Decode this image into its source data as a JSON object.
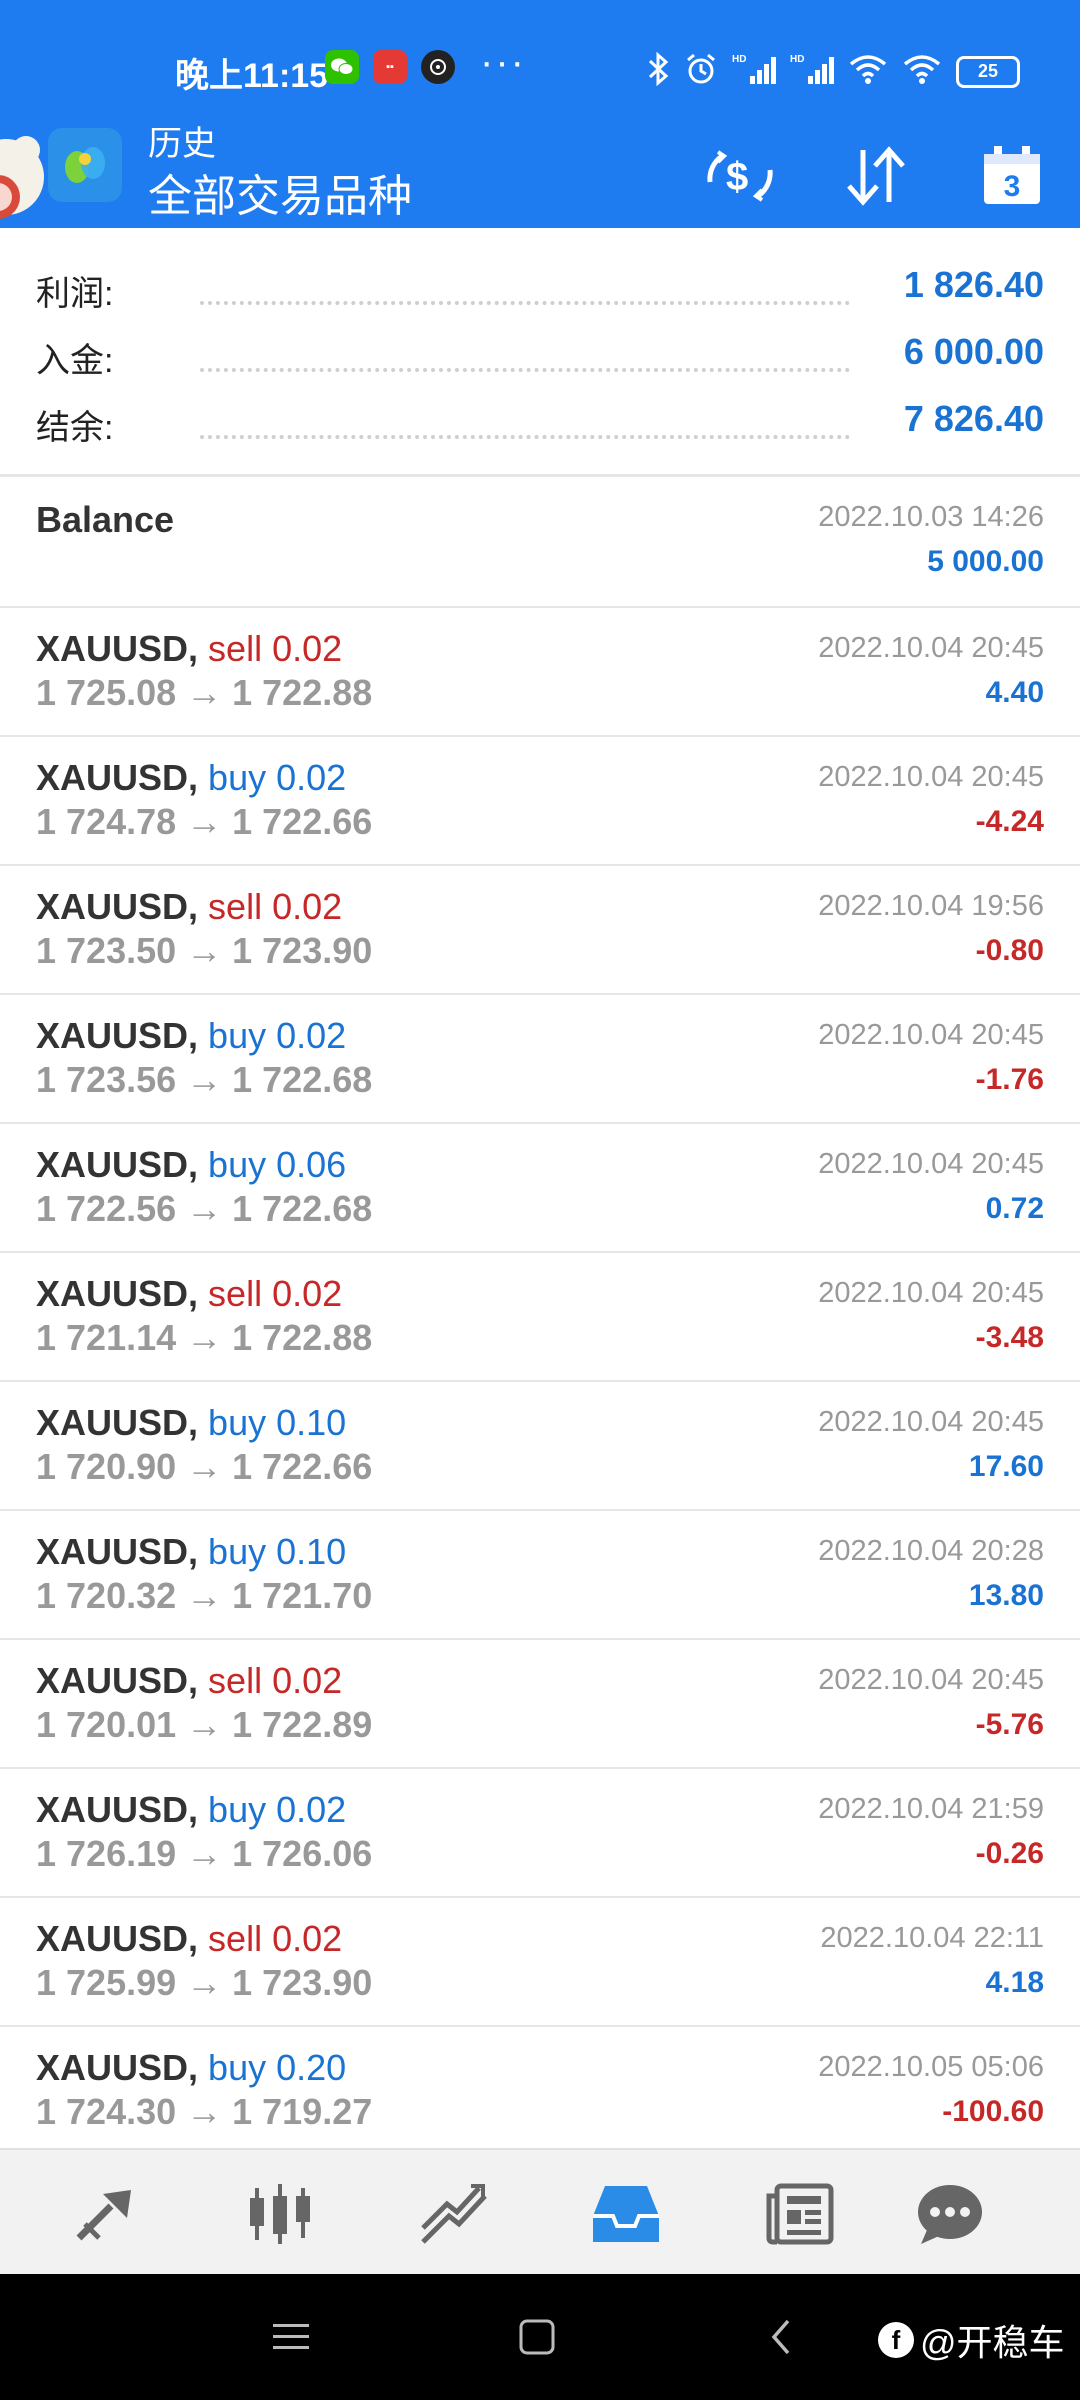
{
  "status_bar": {
    "time": "晚上11:15",
    "more": "···",
    "battery": "25",
    "app_icons": [
      "wechat-icon",
      "alipay-mini-icon",
      "camera-app-icon"
    ]
  },
  "header": {
    "title": "历史",
    "subtitle": "全部交易品种",
    "calendar_day": "3"
  },
  "summary": [
    {
      "label": "利润:",
      "value": "1 826.40"
    },
    {
      "label": "入金:",
      "value": "6 000.00"
    },
    {
      "label": "结余:",
      "value": "7 826.40"
    }
  ],
  "balance_entry": {
    "title": "Balance",
    "time": "2022.10.03 14:26",
    "amount": "5 000.00"
  },
  "trades": [
    {
      "symbol": "XAUUSD,",
      "side": "sell 0.02",
      "type": "sell",
      "prices": "1 725.08 → 1 722.88",
      "time": "2022.10.04 20:45",
      "profit": "4.40",
      "sign": "pos"
    },
    {
      "symbol": "XAUUSD,",
      "side": "buy 0.02",
      "type": "buy",
      "prices": "1 724.78 → 1 722.66",
      "time": "2022.10.04 20:45",
      "profit": "-4.24",
      "sign": "neg"
    },
    {
      "symbol": "XAUUSD,",
      "side": "sell 0.02",
      "type": "sell",
      "prices": "1 723.50 → 1 723.90",
      "time": "2022.10.04 19:56",
      "profit": "-0.80",
      "sign": "neg"
    },
    {
      "symbol": "XAUUSD,",
      "side": "buy 0.02",
      "type": "buy",
      "prices": "1 723.56 → 1 722.68",
      "time": "2022.10.04 20:45",
      "profit": "-1.76",
      "sign": "neg"
    },
    {
      "symbol": "XAUUSD,",
      "side": "buy 0.06",
      "type": "buy",
      "prices": "1 722.56 → 1 722.68",
      "time": "2022.10.04 20:45",
      "profit": "0.72",
      "sign": "pos"
    },
    {
      "symbol": "XAUUSD,",
      "side": "sell 0.02",
      "type": "sell",
      "prices": "1 721.14 → 1 722.88",
      "time": "2022.10.04 20:45",
      "profit": "-3.48",
      "sign": "neg"
    },
    {
      "symbol": "XAUUSD,",
      "side": "buy 0.10",
      "type": "buy",
      "prices": "1 720.90 → 1 722.66",
      "time": "2022.10.04 20:45",
      "profit": "17.60",
      "sign": "pos"
    },
    {
      "symbol": "XAUUSD,",
      "side": "buy 0.10",
      "type": "buy",
      "prices": "1 720.32 → 1 721.70",
      "time": "2022.10.04 20:28",
      "profit": "13.80",
      "sign": "pos"
    },
    {
      "symbol": "XAUUSD,",
      "side": "sell 0.02",
      "type": "sell",
      "prices": "1 720.01 → 1 722.89",
      "time": "2022.10.04 20:45",
      "profit": "-5.76",
      "sign": "neg"
    },
    {
      "symbol": "XAUUSD,",
      "side": "buy 0.02",
      "type": "buy",
      "prices": "1 726.19 → 1 726.06",
      "time": "2022.10.04 21:59",
      "profit": "-0.26",
      "sign": "neg"
    },
    {
      "symbol": "XAUUSD,",
      "side": "sell 0.02",
      "type": "sell",
      "prices": "1 725.99 → 1 723.90",
      "time": "2022.10.04 22:11",
      "profit": "4.18",
      "sign": "pos"
    },
    {
      "symbol": "XAUUSD,",
      "side": "buy 0.20",
      "type": "buy",
      "prices": "1 724.30 → 1 719.27",
      "time": "2022.10.05 05:06",
      "profit": "-100.60",
      "sign": "neg"
    }
  ],
  "bottom_nav": [
    "quotes-icon",
    "chart-icon",
    "trade-icon",
    "history-icon",
    "news-icon",
    "chat-icon"
  ],
  "watermark": "@开稳车",
  "colors": {
    "accent": "#1e7bf0",
    "positive": "#1a73d2",
    "negative": "#c62828",
    "muted": "#999999"
  }
}
